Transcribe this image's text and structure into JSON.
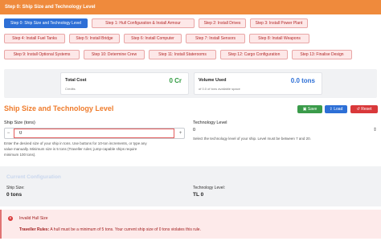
{
  "header": {
    "title": "Step 0: Ship Size and Technology Level"
  },
  "steps": [
    {
      "label": "Step 0: Ship Size and Technology Level",
      "active": true
    },
    {
      "label": "Step 1: Hull Configuration & Install Armour"
    },
    {
      "label": "Step 2: Install Drives"
    },
    {
      "label": "Step 3: Install Power Plant"
    },
    {
      "label": "Step 4: Install Fuel Tanks"
    },
    {
      "label": "Step 5: Install Bridge"
    },
    {
      "label": "Step 6: Install Computer"
    },
    {
      "label": "Step 7: Install Sensors"
    },
    {
      "label": "Step 8: Install Weapons"
    },
    {
      "label": "Step 9: Install Optional Systems"
    },
    {
      "label": "Step 10: Determine Crew"
    },
    {
      "label": "Step 11: Install Staterooms"
    },
    {
      "label": "Step 12: Cargo Configuration"
    },
    {
      "label": "Step 13: Finalise Design"
    }
  ],
  "summary": {
    "total_cost": {
      "label": "Total Cost",
      "sub": "Credits",
      "value": "0 Cr",
      "color": "#2f9a3f"
    },
    "volume_used": {
      "label": "Volume Used",
      "sub": "of 0.0 of tons available space",
      "value": "0.0 tons",
      "color": "#2d6fd6"
    }
  },
  "section": {
    "title": "Ship Size and Technology Level",
    "save": "Save",
    "load": "Load",
    "reset": "Reset"
  },
  "ship_size": {
    "label": "Ship Size (tons)",
    "value": "0",
    "minus": "−",
    "plus": "+",
    "hint_1": "Enter the desired size of your ship in tons. Use buttons for 10-ton increments, or type any",
    "hint_2": "value manually. Minimum size is 5 tons (Traveller rules; jump-capable ships require",
    "hint_3": "minimum 100 tons)."
  },
  "tech_level": {
    "label": "Technology Level",
    "value": "0",
    "hint": "Select the technology level of your ship. Level must be between 7 and 20."
  },
  "current_config": {
    "title": "Current Configuration",
    "ship_size_label": "Ship Size:",
    "ship_size_value": "0 tons",
    "tech_label": "Technology Level:",
    "tech_value": "TL 0"
  },
  "alert": {
    "icon": "×",
    "title": "Invalid Hull Size",
    "rule_label": "Traveller Rules:",
    "message": " A hull must be a minimum of 5 tons. Your current ship size of 0 tons violates this rule."
  },
  "colors": {
    "accent": "#ef8a3c",
    "active_step": "#2d6fd6",
    "step_bg": "#fde8e8",
    "step_text": "#b32828",
    "error": "#d93a3a"
  }
}
